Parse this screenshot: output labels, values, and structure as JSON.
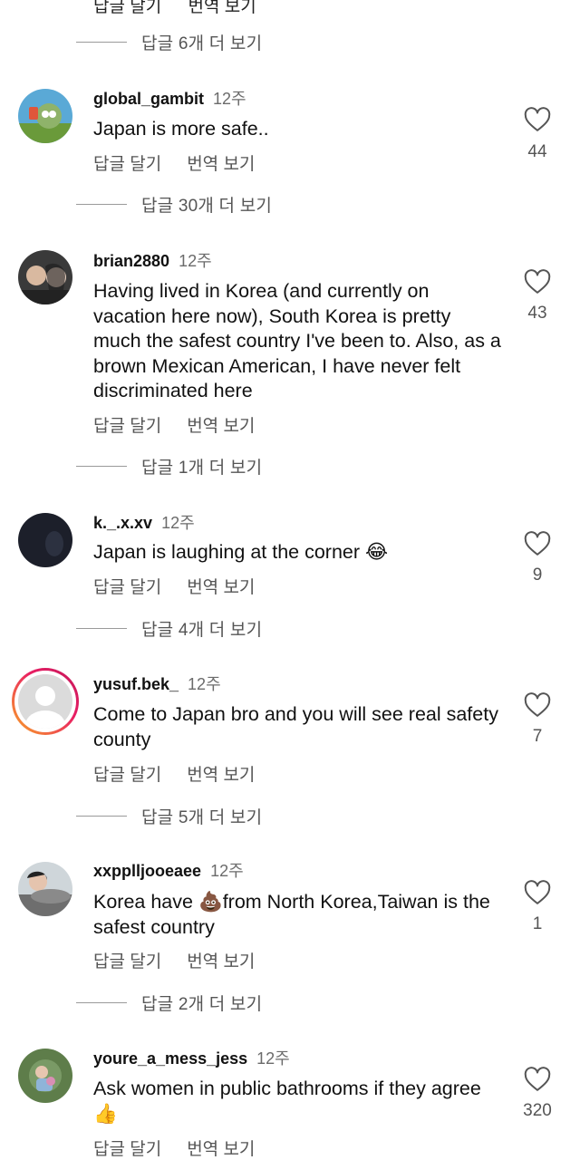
{
  "top_actions": {
    "reply": "답글 달기",
    "translate": "번역 보기"
  },
  "more_replies": [
    "답글 6개 더 보기",
    "답글 30개 더 보기",
    "답글 1개 더 보기",
    "답글 4개 더 보기",
    "답글 5개 더 보기",
    "답글 2개 더 보기"
  ],
  "comments": [
    {
      "username": "global_gambit",
      "time": "12주",
      "text": "Japan is more safe..",
      "likes": "44",
      "reply": "답글 달기",
      "translate": "번역 보기"
    },
    {
      "username": "brian2880",
      "time": "12주",
      "text": "Having lived in Korea (and currently on vacation here now), South Korea is pretty much the safest country I've been to. Also, as a brown Mexican American, I have never felt discriminated here",
      "likes": "43",
      "reply": "답글 달기",
      "translate": "번역 보기"
    },
    {
      "username": "k._.x.xv",
      "time": "12주",
      "text": "Japan is laughing at the corner 😂",
      "likes": "9",
      "reply": "답글 달기",
      "translate": "번역 보기"
    },
    {
      "username": "yusuf.bek_",
      "time": "12주",
      "text": "Come to Japan bro and you will see real safety county",
      "likes": "7",
      "reply": "답글 달기",
      "translate": "번역 보기"
    },
    {
      "username": "xxpplljooeaee",
      "time": "12주",
      "text": "Korea have 💩from North Korea,Taiwan is the safest country",
      "likes": "1",
      "reply": "답글 달기",
      "translate": "번역 보기"
    },
    {
      "username": "youre_a_mess_jess",
      "time": "12주",
      "text": "Ask women in public bathrooms if they agree👍",
      "likes": "320",
      "reply": "답글 달기",
      "translate": "번역 보기"
    }
  ],
  "icons": {
    "like": "heart-outline-icon"
  },
  "colors": {
    "story_ring_start": "#f9a825",
    "story_ring_end": "#c2185b"
  }
}
